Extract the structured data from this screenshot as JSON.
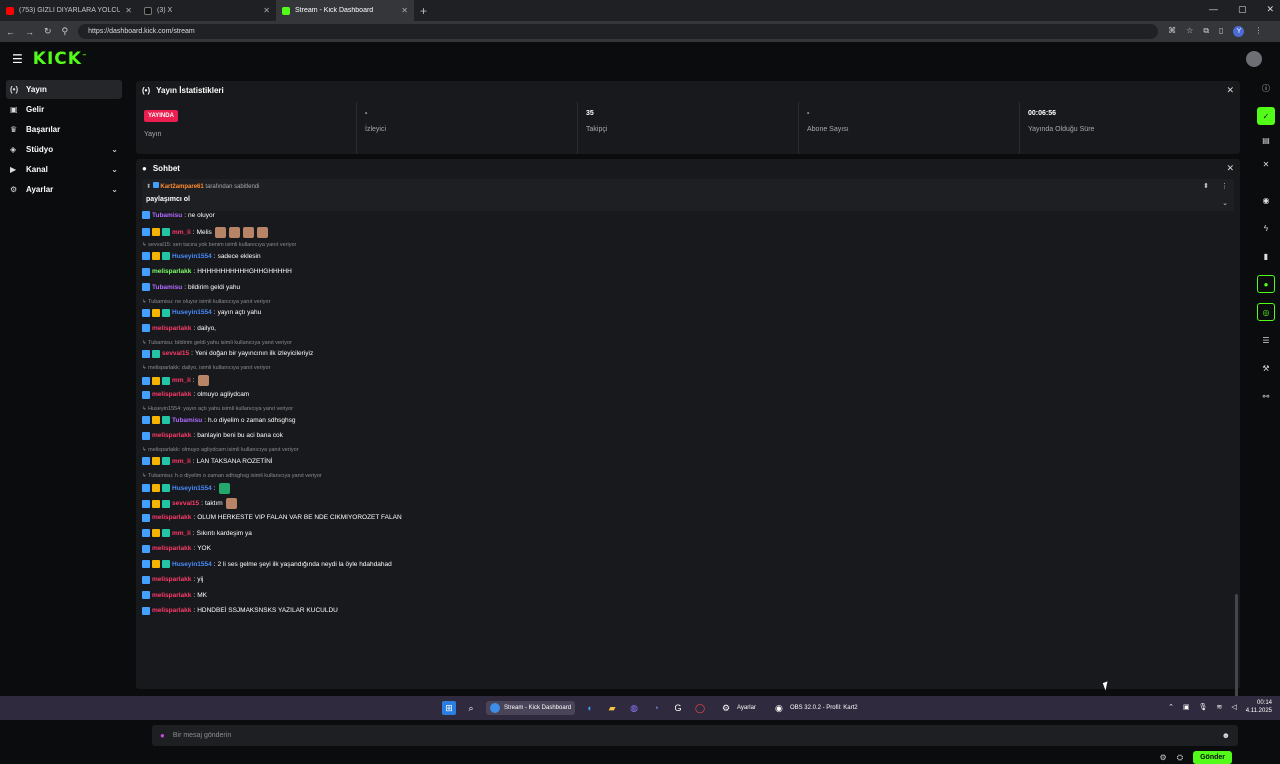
{
  "browser": {
    "tabs": [
      {
        "title": "(753) GİZLİ DİYARLARA YOLCUL",
        "favicon_color": "#ff0000",
        "active": false
      },
      {
        "title": "(3) X",
        "favicon_color": "#111111",
        "active": false
      },
      {
        "title": "Stream - Kick Dashboard",
        "favicon_color": "#53fc18",
        "active": true
      }
    ],
    "new_tab": "+",
    "url": "https://dashboard.kick.com/stream",
    "profile_initial": "Y"
  },
  "app": {
    "logo": "KICK",
    "accent": "#53fc18"
  },
  "sidebar": {
    "items": [
      {
        "label": "Yayın",
        "icon": "broadcast-icon",
        "glyph": "((•))",
        "active": true,
        "expandable": false
      },
      {
        "label": "Gelir",
        "icon": "wallet-icon",
        "glyph": "▣",
        "active": false,
        "expandable": false
      },
      {
        "label": "Başarılar",
        "icon": "trophy-icon",
        "glyph": "🏆",
        "active": false,
        "expandable": false
      },
      {
        "label": "Stüdyo",
        "icon": "studio-icon",
        "glyph": "◈",
        "active": false,
        "expandable": true
      },
      {
        "label": "Kanal",
        "icon": "channel-icon",
        "glyph": "▶",
        "active": false,
        "expandable": true
      },
      {
        "label": "Ayarlar",
        "icon": "settings-icon",
        "glyph": "⚙",
        "active": false,
        "expandable": true
      }
    ]
  },
  "stats_panel": {
    "title": "Yayın İstatistikleri",
    "live_badge": "YAYINDA",
    "items": [
      {
        "value": "",
        "label": "Yayın"
      },
      {
        "value": "-",
        "label": "İzleyici"
      },
      {
        "value": "35",
        "label": "Takipçi"
      },
      {
        "value": "-",
        "label": "Abone Sayısı"
      },
      {
        "value": "00:06:56",
        "label": "Yayında Olduğu Süre"
      }
    ]
  },
  "chat_panel": {
    "title": "Sohbet",
    "pinned": {
      "user": "Kart2ampare61",
      "suffix": "tarafından sabitlendi",
      "text": "paylaşımcı ol"
    },
    "messages": [
      {
        "type": "msg",
        "badges": [
          "mod"
        ],
        "user": "Tubamisu",
        "color": "#b06cff",
        "text": "ne oluyor",
        "emotes": 0
      },
      {
        "type": "msg",
        "badges": [
          "mod",
          "vip",
          "sub"
        ],
        "user": "mm_li",
        "color": "#ff3b6b",
        "text": "Melis",
        "emotes": 4
      },
      {
        "type": "reply",
        "text": "sevval15: sen tacıra yok benim isimli kullanıcıya yanıt veriyor"
      },
      {
        "type": "msg",
        "badges": [
          "mod",
          "vip",
          "sub"
        ],
        "user": "Huseyin1554",
        "color": "#4a8cff",
        "text": "sadece eklesin",
        "emotes": 0
      },
      {
        "type": "msg",
        "badges": [
          "mod"
        ],
        "user": "melisparlakk",
        "color": "#7dff6b",
        "text": "HHHHHHHHHHHGHHGHHHHH",
        "emotes": 0
      },
      {
        "type": "msg",
        "badges": [
          "mod"
        ],
        "user": "Tubamisu",
        "color": "#b06cff",
        "text": "bildirim geldi yahu",
        "emotes": 0
      },
      {
        "type": "reply",
        "text": "Tubamisu: ne oluyor isimli kullanıcıya yanıt veriyor"
      },
      {
        "type": "msg",
        "badges": [
          "mod",
          "vip",
          "sub"
        ],
        "user": "Huseyin1554",
        "color": "#4a8cff",
        "text": "yayın açtı yahu",
        "emotes": 0
      },
      {
        "type": "msg",
        "badges": [
          "mod"
        ],
        "user": "melisparlakk",
        "color": "#ff3b6b",
        "text": "dailyo,",
        "emotes": 0
      },
      {
        "type": "reply",
        "text": "Tubamisu: bildirim geldi yahu isimli kullanıcıya yanıt veriyor"
      },
      {
        "type": "msg",
        "badges": [
          "mod",
          "sub"
        ],
        "user": "sevval15",
        "color": "#ff3b6b",
        "text": "Yeni doğan bir yayıncının ilk izleyicileriyiz",
        "emotes": 0
      },
      {
        "type": "reply",
        "text": "melisparlakk: dailyo, isimli kullanıcıya yanıt veriyor"
      },
      {
        "type": "msg",
        "badges": [
          "mod",
          "vip",
          "sub"
        ],
        "user": "mm_li",
        "color": "#ff3b6b",
        "text": "",
        "emotes": 1
      },
      {
        "type": "msg",
        "badges": [
          "mod"
        ],
        "user": "melisparlakk",
        "color": "#ff3b6b",
        "text": "olmuyo agliydcam",
        "emotes": 0
      },
      {
        "type": "reply",
        "text": "Huseyin1554: yayın açtı yahu isimli kullanıcıya yanıt veriyor"
      },
      {
        "type": "msg",
        "badges": [
          "mod",
          "vip",
          "sub"
        ],
        "user": "Tubamisu",
        "color": "#b06cff",
        "text": "h.o diyelim o zaman sdhsghsg",
        "emotes": 0
      },
      {
        "type": "msg",
        "badges": [
          "mod"
        ],
        "user": "melisparlakk",
        "color": "#ff3b6b",
        "text": "banlayin beni bu aci bana cok",
        "emotes": 0
      },
      {
        "type": "reply",
        "text": "melisparlakk: olmuyo agliydcam isimli kullanıcıya yanıt veriyor"
      },
      {
        "type": "msg",
        "badges": [
          "mod",
          "vip",
          "sub"
        ],
        "user": "mm_li",
        "color": "#ff3b6b",
        "text": "LAN TAKSANA ROZETİNİ",
        "emotes": 0
      },
      {
        "type": "reply",
        "text": "Tubamisu: h.o diyelim o zaman sdhsghsg isimli kullanıcıya yanıt veriyor"
      },
      {
        "type": "msg",
        "badges": [
          "mod",
          "vip",
          "sub"
        ],
        "user": "Huseyin1554",
        "color": "#4a8cff",
        "text": "",
        "emotes": 1,
        "emote_green": true
      },
      {
        "type": "msg",
        "badges": [
          "mod",
          "vip",
          "sub"
        ],
        "user": "sevval15",
        "color": "#ff3b6b",
        "text": "taktım",
        "emotes": 1
      },
      {
        "type": "msg",
        "badges": [
          "mod"
        ],
        "user": "melisparlakk",
        "color": "#ff3b6b",
        "text": "OLUM HERKESTE VIP FALAN VAR BE NDE CIKMIYOROZET FALAN",
        "emotes": 0
      },
      {
        "type": "msg",
        "badges": [
          "mod",
          "vip",
          "sub"
        ],
        "user": "mm_li",
        "color": "#ff3b6b",
        "text": "Sıkıntı kardeşim ya",
        "emotes": 0
      },
      {
        "type": "msg",
        "badges": [
          "mod"
        ],
        "user": "melisparlakk",
        "color": "#ff3b6b",
        "text": "YOK",
        "emotes": 0
      },
      {
        "type": "msg",
        "badges": [
          "mod",
          "vip",
          "sub"
        ],
        "user": "Huseyin1554",
        "color": "#4a8cff",
        "text": "2 li ses gelme şeyi ilk yaşandığında neydi la öyle hdahdahad",
        "emotes": 0
      },
      {
        "type": "msg",
        "badges": [
          "mod"
        ],
        "user": "melisparlakk",
        "color": "#ff3b6b",
        "text": "yij",
        "emotes": 0
      },
      {
        "type": "msg",
        "badges": [
          "mod"
        ],
        "user": "melisparlakk",
        "color": "#ff3b6b",
        "text": "MK",
        "emotes": 0
      },
      {
        "type": "msg",
        "badges": [
          "mod"
        ],
        "user": "melisparlakk",
        "color": "#ff3b6b",
        "text": "HDNDBEİ SSJMAKSNSKS YAZILAR KUCULDU",
        "emotes": 0
      }
    ],
    "input_placeholder": "Bir mesaj gönderin",
    "send_label": "Gönder"
  },
  "taskbar": {
    "apps": [
      {
        "label": "Stream - Kick Dashboard",
        "active": true
      },
      {
        "label": "Ayarlar",
        "active": false
      },
      {
        "label": "OBS 32.0.2 - Profil: Kart2",
        "active": false
      }
    ],
    "time": "00:14",
    "date": "4.11.2025"
  }
}
